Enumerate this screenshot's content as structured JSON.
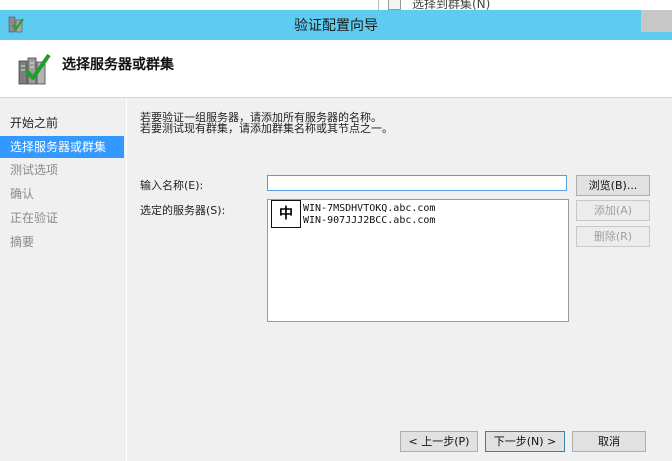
{
  "background_window": {
    "title": "选择到群集(N)"
  },
  "window": {
    "title": "验证配置向导"
  },
  "header": {
    "title": "选择服务器或群集"
  },
  "nav": {
    "items": [
      {
        "label": "开始之前",
        "state": "done"
      },
      {
        "label": "选择服务器或群集",
        "state": "active"
      },
      {
        "label": "测试选项",
        "state": "pending"
      },
      {
        "label": "确认",
        "state": "pending"
      },
      {
        "label": "正在验证",
        "state": "pending"
      },
      {
        "label": "摘要",
        "state": "pending"
      }
    ]
  },
  "content": {
    "intro_line1": "若要验证一组服务器，请添加所有服务器的名称。",
    "intro_line2": "若要测试现有群集，请添加群集名称或其节点之一。",
    "name_label": "输入名称(E):",
    "name_value": "",
    "servers_label": "选定的服务器(S):",
    "servers": [
      "WIN-7MSDHVTOKQ.abc.com",
      "WIN-907JJJ2BCC.abc.com"
    ],
    "ime_indicator": "中",
    "browse_button": "浏览(B)...",
    "add_button": "添加(A)",
    "remove_button": "删除(R)"
  },
  "footer": {
    "prev_button": "< 上一步(P)",
    "next_button": "下一步(N) >",
    "cancel_button": "取消"
  },
  "colors": {
    "titlebar": "#5ecbf0",
    "nav_active": "#3399ff",
    "panel": "#f0f0f0"
  }
}
